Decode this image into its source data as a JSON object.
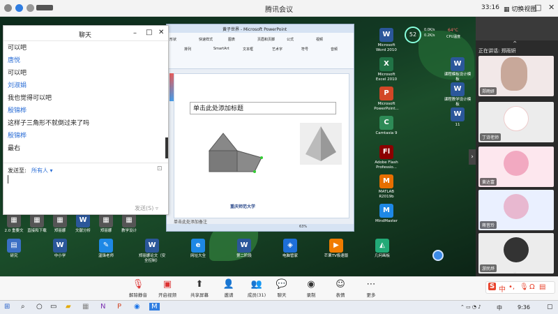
{
  "app": {
    "title": "腾讯会议",
    "time": "33:16",
    "switch_view": "切换视图"
  },
  "chat": {
    "title": "聊天",
    "messages": [
      {
        "sender": "",
        "text": "可以吧"
      },
      {
        "sender": "唐悦",
        "text": "可以吧"
      },
      {
        "sender": "刘淑娟",
        "text": "我也觉得可以吧"
      },
      {
        "sender": "殷锦桦",
        "text": "这样子三角形不就倒过来了吗"
      },
      {
        "sender": "殷锦桦",
        "text": "最右"
      }
    ],
    "send_to_label": "发送至:",
    "send_to_value": "所有人",
    "send_button": "发送(S)"
  },
  "ppt": {
    "window_title": "黄子世界 - Microsoft PowerPoint",
    "slide_title_placeholder": "单击此处添加标题",
    "notes_placeholder": "单击此处添加备注",
    "zoom": "63%",
    "footer_logo_text": "重庆师范大学",
    "ribbon_labels": [
      "形状",
      "排列",
      "快速样式",
      "SmartArt",
      "图表",
      "文本框",
      "页眉和页脚",
      "艺术字",
      "公式",
      "符号",
      "视频",
      "音频"
    ]
  },
  "desktop_icons_right": [
    {
      "label": "Microsoft Word 2010",
      "glyph": "W",
      "color": "#2b579a"
    },
    {
      "label": "Microsoft Excel 2010",
      "glyph": "X",
      "color": "#217346"
    },
    {
      "label": "Microsoft PowerPoint...",
      "glyph": "P",
      "color": "#d24726"
    },
    {
      "label": "Camtasia 9",
      "glyph": "C",
      "color": "#2e8b57"
    },
    {
      "label": "Adobe Flash Professio...",
      "glyph": "Fl",
      "color": "#8b0000"
    },
    {
      "label": "MATLAB R2019b",
      "glyph": "M",
      "color": "#e76f00"
    },
    {
      "label": "MindMaster",
      "glyph": "M",
      "color": "#1e88e5"
    }
  ],
  "desktop_icons_right2": [
    {
      "label": "课程模板设计模板",
      "glyph": "W",
      "color": "#2b579a"
    },
    {
      "label": "课程教学设计模板",
      "glyph": "W",
      "color": "#2b579a"
    },
    {
      "label": "11",
      "glyph": "W",
      "color": "#2b579a"
    }
  ],
  "desktop_icons_bottom": [
    {
      "label": "2.0 重要文",
      "glyph": "▦",
      "color": "#555"
    },
    {
      "label": "直接和下载",
      "glyph": "▦",
      "color": "#555"
    },
    {
      "label": "郑丽娜",
      "glyph": "▦",
      "color": "#555"
    },
    {
      "label": "文献分析",
      "glyph": "W",
      "color": "#2b579a"
    },
    {
      "label": "郑丽娜",
      "glyph": "▦",
      "color": "#555"
    },
    {
      "label": "教学设计",
      "glyph": "▦",
      "color": "#555"
    }
  ],
  "desktop_icons_bottom2": [
    {
      "label": "研究",
      "glyph": "▤",
      "color": "#3a6fc4"
    },
    {
      "label": "中小学",
      "glyph": "W",
      "color": "#2b579a"
    },
    {
      "label": "温锋老师",
      "glyph": "✎",
      "color": "#1e88e5"
    },
    {
      "label": "郑丽娜论文（安全控制）",
      "glyph": "W",
      "color": "#2b579a"
    },
    {
      "label": "网址大全",
      "glyph": "e",
      "color": "#1e88e5"
    },
    {
      "label": "第二阶段",
      "glyph": "W",
      "color": "#2b579a"
    },
    {
      "label": "电脑管家",
      "glyph": "◈",
      "color": "#1e6fd8"
    },
    {
      "label": "芒果TV极速版",
      "glyph": "▶",
      "color": "#f07c00"
    },
    {
      "label": "几何画板",
      "glyph": "◭",
      "color": "#2a7"
    }
  ],
  "widget": {
    "percent": "52",
    "up": "0.0K/s",
    "down": "0.2K/s",
    "temp": "64°C",
    "cpu": "CPU温度"
  },
  "right_panel": {
    "speaking_label": "正在讲话:",
    "speaking_name": "郑雨妍",
    "participants": [
      {
        "name": "郑雨妍"
      },
      {
        "name": "丁诗老师"
      },
      {
        "name": "黄达富"
      },
      {
        "name": "蒋昔玲"
      },
      {
        "name": "游民烨"
      }
    ]
  },
  "toolbar": {
    "unmute": "解除静音",
    "video": "开启视频",
    "share": "共享屏幕",
    "invite": "邀请",
    "members": "成员(31)",
    "chat": "聊天",
    "record": "录制",
    "reaction": "表情",
    "more": "更多"
  },
  "taskbar": {
    "time": "9:36",
    "lang": "中"
  },
  "ime": {
    "label": "中"
  }
}
